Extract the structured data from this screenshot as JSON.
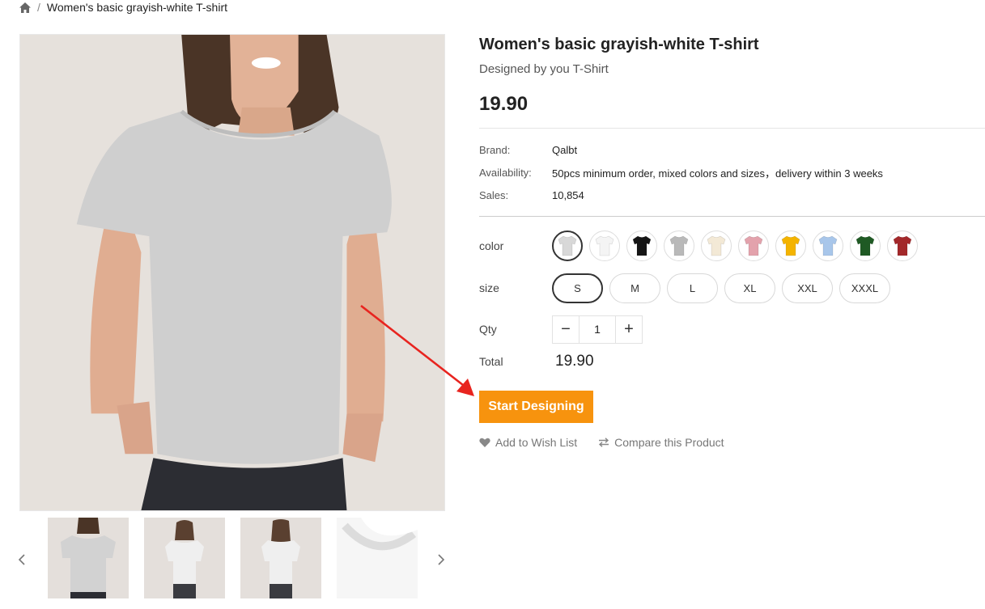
{
  "breadcrumb": {
    "home_icon": "home-icon",
    "separator": "/",
    "current": "Women's basic grayish-white T-shirt"
  },
  "gallery": {
    "prev_icon": "chevron-left-icon",
    "next_icon": "chevron-right-icon",
    "thumbnails": [
      "front-view",
      "front-full-view",
      "back-view",
      "collar-detail"
    ]
  },
  "product": {
    "title": "Women's basic grayish-white T-shirt",
    "subtitle": "Designed by you T-Shirt",
    "price": "19.90"
  },
  "info": {
    "brand_label": "Brand:",
    "brand_value": "Qalbt",
    "availability_label": "Availability:",
    "availability_value": "50pcs minimum order, mixed colors and sizes，delivery within 3 weeks",
    "sales_label": "Sales:",
    "sales_value": "10,854"
  },
  "options": {
    "color_label": "color",
    "colors": [
      "#d8d8d8",
      "#f4f4f4",
      "#151515",
      "#b9b9b9",
      "#f3e9d6",
      "#e3a2ac",
      "#f4b400",
      "#a8c6ea",
      "#1f5a24",
      "#a3282a"
    ],
    "selected_color_index": 0,
    "size_label": "size",
    "sizes": [
      "S",
      "M",
      "L",
      "XL",
      "XXL",
      "XXXL"
    ],
    "selected_size": "S",
    "qty_label": "Qty",
    "qty_value": "1",
    "qty_minus": "−",
    "qty_plus": "+",
    "total_label": "Total",
    "total_value": "19.90"
  },
  "actions": {
    "start_designing": "Start Designing",
    "wish_list": "Add to Wish List",
    "compare": "Compare this Product"
  },
  "colors": {
    "accent": "#f7930e",
    "annotation": "#e8241f"
  }
}
